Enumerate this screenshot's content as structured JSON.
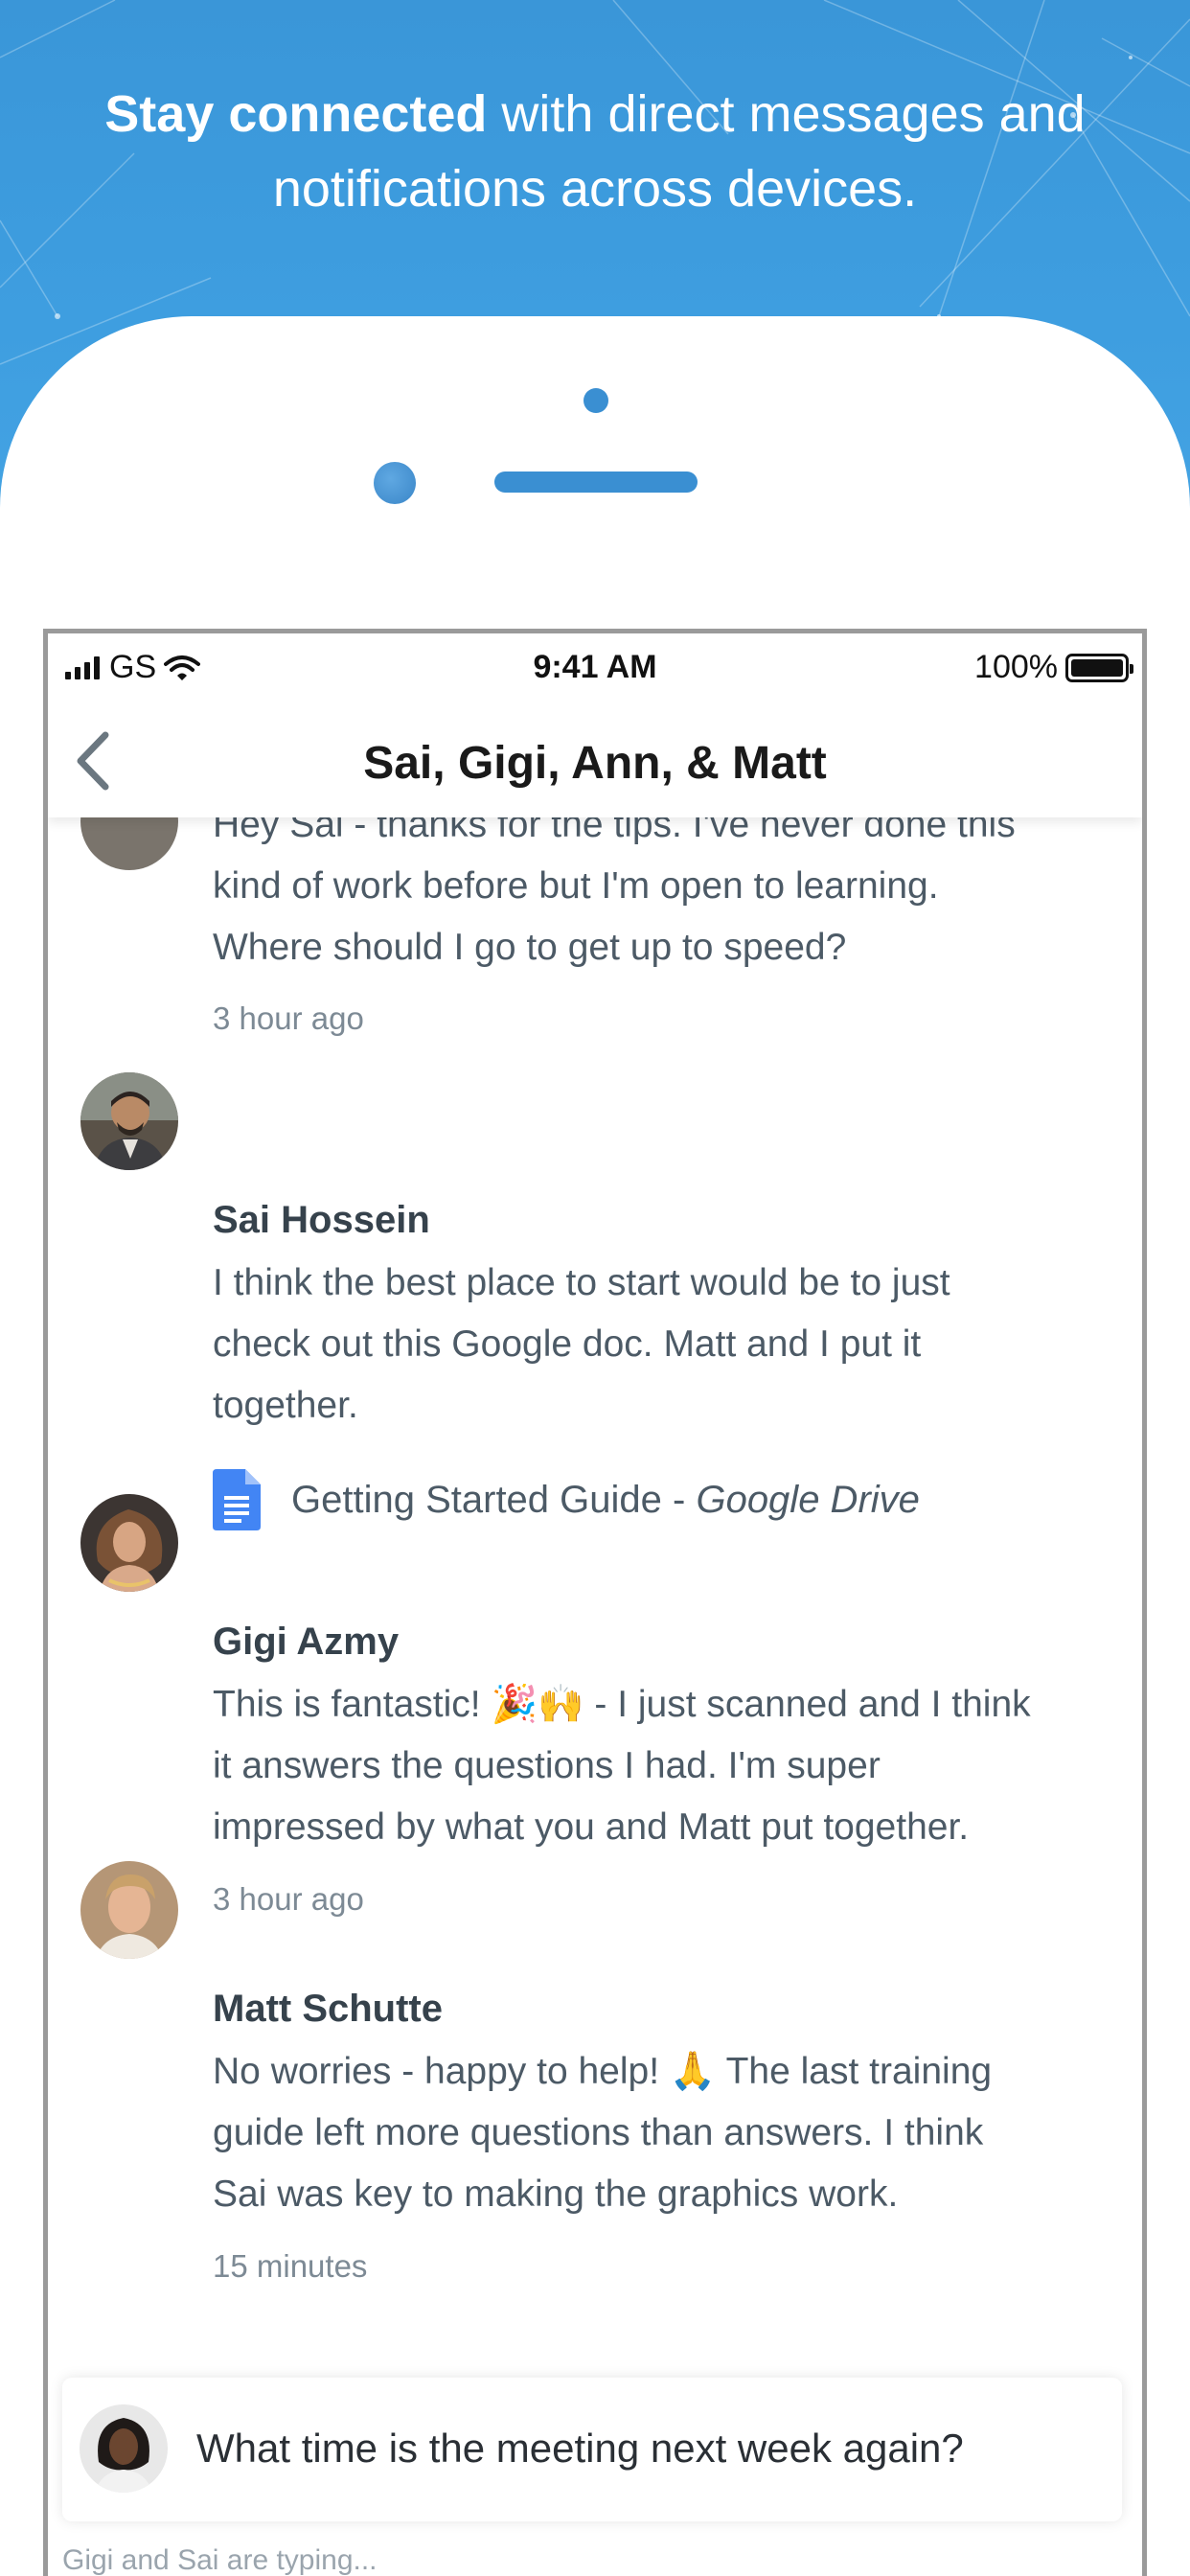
{
  "headline": {
    "bold": "Stay connected",
    "line1_rest": " with direct messages and",
    "line2": "notifications across devices."
  },
  "status_bar": {
    "carrier": "GS",
    "time": "9:41 AM",
    "battery": "100%"
  },
  "conversation": {
    "title": "Sai, Gigi, Ann, & Matt"
  },
  "messages": [
    {
      "partial_line": "Hey Sai - thanks for the tips. I've never done this",
      "lines": [
        "kind of work before but I'm open to learning.",
        "Where should I go to get up to speed?"
      ],
      "time": "3 hour ago"
    },
    {
      "name": "Sai Hossein",
      "lines": [
        "I think the best place to start would be to just",
        "check out this Google doc. Matt and I put it",
        "together."
      ],
      "attachment": {
        "title": "Getting Started Guide - ",
        "source": "Google Drive",
        "icon": "google-docs-icon"
      }
    },
    {
      "name": "Gigi Azmy",
      "line1_a": "This is fantastic! ",
      "emoji1": "🎉🙌",
      "line1_b": " - I just scanned and I think",
      "lines": [
        "it answers the questions I had. I'm super",
        "impressed by what you and Matt put together."
      ],
      "time": "3 hour ago"
    },
    {
      "name": "Matt Schutte",
      "line1_a": "No worries - happy to help! ",
      "emoji1": "🙏",
      "line1_b": " The last training",
      "lines": [
        "guide left more questions than answers. I think",
        "Sai was key to making the graphics work."
      ],
      "time": "15 minutes"
    }
  ],
  "composer": {
    "text": "What time is the meeting next week again?"
  },
  "typing_indicator": "Gigi and Sai are typing...",
  "colors": {
    "banner": "#3e9ee0",
    "accent": "#3a8fd2",
    "doc_blue": "#4285f4"
  }
}
